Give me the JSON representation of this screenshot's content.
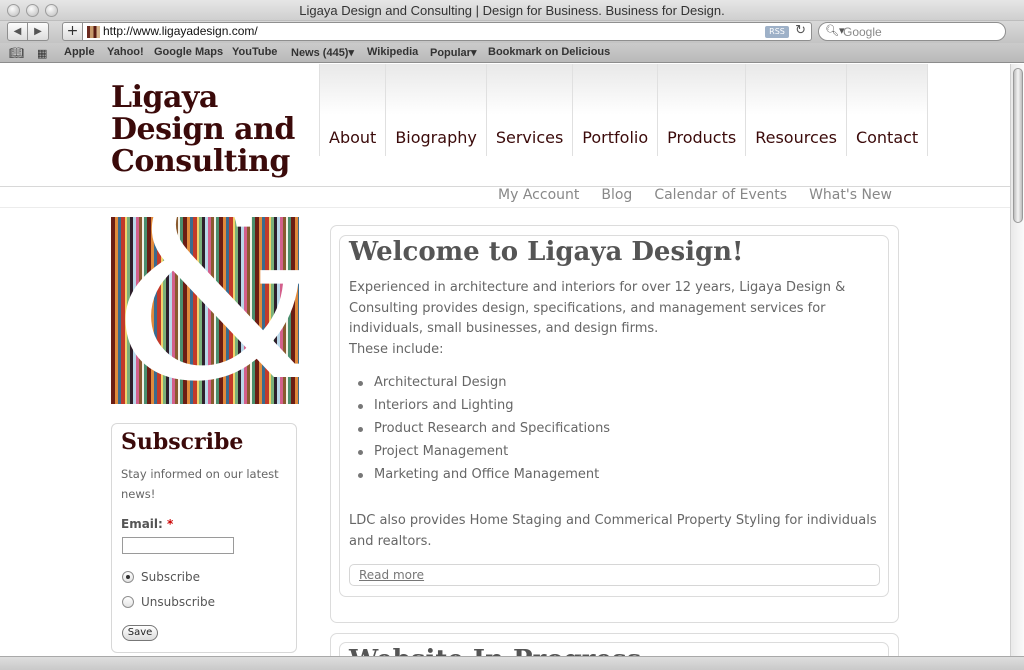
{
  "window": {
    "title": "Ligaya Design and Consulting | Design for Business. Business for Design."
  },
  "toolbar": {
    "back_icon": "back-arrow-icon",
    "forward_icon": "forward-arrow-icon",
    "add_label": "+",
    "url": "http://www.ligayadesign.com/",
    "rss_label": "RSS",
    "reload_glyph": "↻",
    "search_placeholder": "Google"
  },
  "bookmarks": {
    "items": [
      "Apple",
      "Yahoo!",
      "Google Maps",
      "YouTube",
      "News (445)▾",
      "Wikipedia",
      "Popular▾",
      "Bookmark on Delicious"
    ]
  },
  "site": {
    "logo_lines": [
      "Ligaya",
      "Design and",
      "Consulting"
    ],
    "nav": [
      "About",
      "Biography",
      "Services",
      "Portfolio",
      "Products",
      "Resources",
      "Contact"
    ],
    "subnav": [
      "My Account",
      "Blog",
      "Calendar of Events",
      "What's New"
    ]
  },
  "subscribe": {
    "title": "Subscribe",
    "text": "Stay informed on our latest news!",
    "email_label": "Email:",
    "required_mark": "*",
    "email_value": "",
    "options": [
      "Subscribe",
      "Unsubscribe"
    ],
    "selected": "Subscribe",
    "save_label": "Save"
  },
  "welcome": {
    "title": "Welcome to Ligaya Design!",
    "intro": "Experienced in architecture and interiors for over 12 years, Ligaya Design & Consulting provides design, specifications, and management services for individuals, small businesses, and design firms.",
    "includes": "These include:",
    "services": [
      "Architectural Design",
      "Interiors and Lighting",
      "Product Research and Specifications",
      "Project Management",
      "Marketing and Office Management"
    ],
    "staging": "LDC also provides Home Staging and Commerical Property Styling for individuals and realtors.",
    "read_more": "Read more"
  },
  "second_block": {
    "title": "Website In Progress"
  },
  "colors": {
    "brand": "#3b0a0a",
    "text": "#666666",
    "nav_text": "#3b0a0a",
    "subnav_text": "#888888",
    "required": "#cc0000"
  }
}
